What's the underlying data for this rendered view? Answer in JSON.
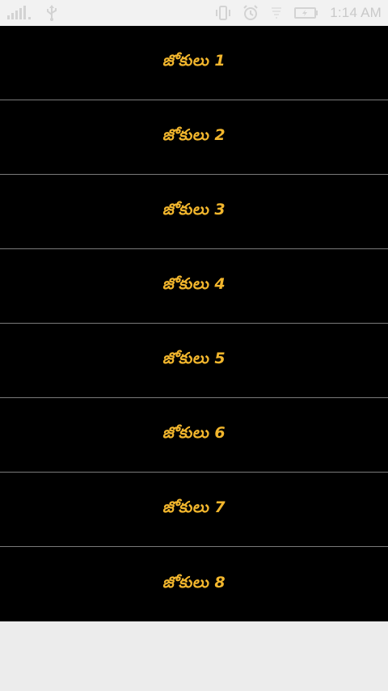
{
  "status_bar": {
    "time": "1:14 AM",
    "icons": [
      "signal-icon",
      "usb-icon",
      "vibrate-icon",
      "alarm-icon",
      "wifi-icon",
      "battery-charging-icon"
    ]
  },
  "list": {
    "items": [
      {
        "label": "జోకులు 1"
      },
      {
        "label": "జోకులు 2"
      },
      {
        "label": "జోకులు 3"
      },
      {
        "label": "జోకులు 4"
      },
      {
        "label": "జోకులు 5"
      },
      {
        "label": "జోకులు 6"
      },
      {
        "label": "జోకులు 7"
      },
      {
        "label": "జోకులు 8"
      }
    ]
  },
  "colors": {
    "list_background": "#000000",
    "label": "#f2b62d",
    "divider": "#7a7a7a",
    "status_bar": "#f2f2f2"
  }
}
